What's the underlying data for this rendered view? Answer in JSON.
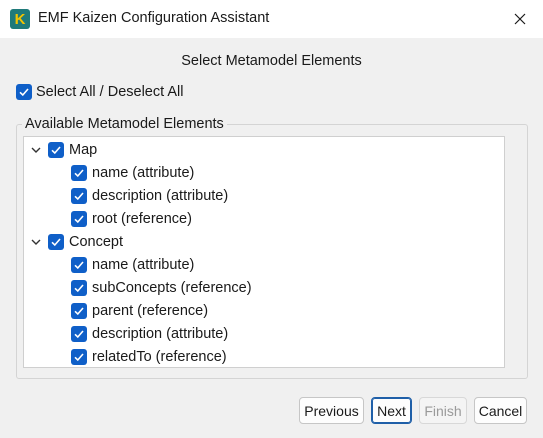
{
  "window": {
    "title": "EMF Kaizen Configuration Assistant",
    "app_icon_letter": "K"
  },
  "page": {
    "heading": "Select Metamodel Elements"
  },
  "select_all": {
    "label": "Select All / Deselect All",
    "checked": true
  },
  "group": {
    "legend": "Available Metamodel Elements"
  },
  "tree": {
    "nodes": [
      {
        "label": "Map",
        "checked": true,
        "expanded": true,
        "children": [
          {
            "label": "name (attribute)",
            "checked": true
          },
          {
            "label": "description (attribute)",
            "checked": true
          },
          {
            "label": "root (reference)",
            "checked": true
          }
        ]
      },
      {
        "label": "Concept",
        "checked": true,
        "expanded": true,
        "children": [
          {
            "label": "name (attribute)",
            "checked": true
          },
          {
            "label": "subConcepts (reference)",
            "checked": true
          },
          {
            "label": "parent (reference)",
            "checked": true
          },
          {
            "label": "description (attribute)",
            "checked": true
          },
          {
            "label": "relatedTo (reference)",
            "checked": true
          }
        ]
      }
    ]
  },
  "buttons": {
    "previous": "Previous",
    "next": "Next",
    "finish": "Finish",
    "cancel": "Cancel"
  },
  "colors": {
    "accent": "#0f5fc8",
    "background": "#f0f0f0"
  }
}
